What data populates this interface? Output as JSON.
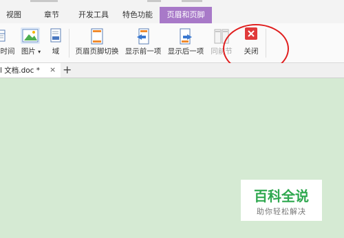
{
  "ribbon_tabs": {
    "view": "视图",
    "chapter": "章节",
    "dev_tools": "开发工具",
    "special": "特色功能",
    "header_footer": "页眉和页脚"
  },
  "toolbar": {
    "datetime": "时间",
    "picture": "图片",
    "field": "域",
    "switch_header_footer": "页眉页脚切换",
    "show_previous": "显示前一项",
    "show_next": "显示后一项",
    "same_as_previous": "同前节",
    "close": "关闭"
  },
  "document_tab": {
    "name": "l 文档.doc *",
    "close": "×",
    "new_tab": "+"
  },
  "watermark": {
    "title": "百科全说",
    "subtitle": "助你轻松解决"
  },
  "colors": {
    "active_tab": "#a879c8",
    "document_bg": "#d5ead3",
    "close_red": "#e03a3a",
    "annotation": "#e01e1e",
    "watermark_green": "#2fa84f"
  }
}
